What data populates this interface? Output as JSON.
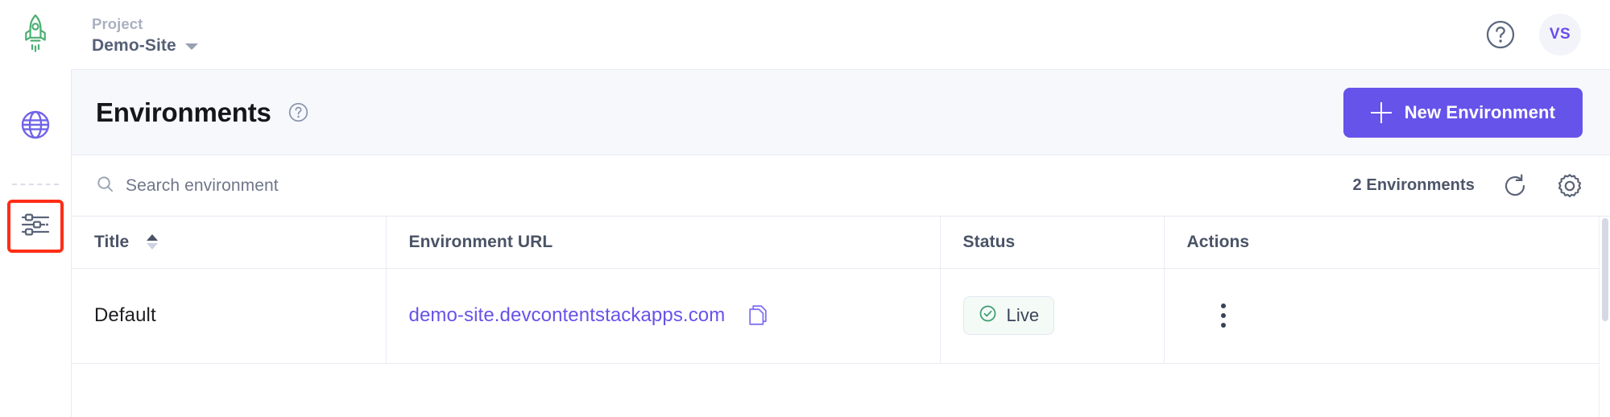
{
  "app": {
    "logo_icon": "rocket-icon",
    "accent_color": "#6653ea",
    "logo_color": "#4caf72"
  },
  "sidebar": {
    "items": [
      {
        "icon": "globe-icon",
        "name": "globe",
        "selected": false
      },
      {
        "icon": "sliders-settings-icon",
        "name": "settings-sliders",
        "selected": true
      }
    ],
    "highlight_color": "#ff2d16"
  },
  "topbar": {
    "project_label": "Project",
    "project_name": "Demo-Site",
    "caret_icon": "chevron-down-icon",
    "help_icon": "help-circle-icon",
    "avatar_initials": "VS"
  },
  "page": {
    "title": "Environments",
    "title_help_icon": "help-circle-icon",
    "new_button_label": "New Environment",
    "new_button_icon": "plus-icon"
  },
  "toolbar": {
    "search_placeholder": "Search environment",
    "search_value": "",
    "search_icon": "search-icon",
    "count_label": "2 Environments",
    "refresh_icon": "refresh-icon",
    "settings_icon": "gear-icon"
  },
  "table": {
    "columns": [
      {
        "label": "Title",
        "sortable": true
      },
      {
        "label": "Environment URL",
        "sortable": false
      },
      {
        "label": "Status",
        "sortable": false
      },
      {
        "label": "Actions",
        "sortable": false
      }
    ],
    "rows": [
      {
        "title": "Default",
        "url": "demo-site.devcontentstackapps.com",
        "copy_icon": "copy-icon",
        "status": "Live",
        "status_icon": "check-circle-icon",
        "status_color": "#3c9d6e",
        "actions_icon": "kebab-menu-icon"
      }
    ]
  }
}
